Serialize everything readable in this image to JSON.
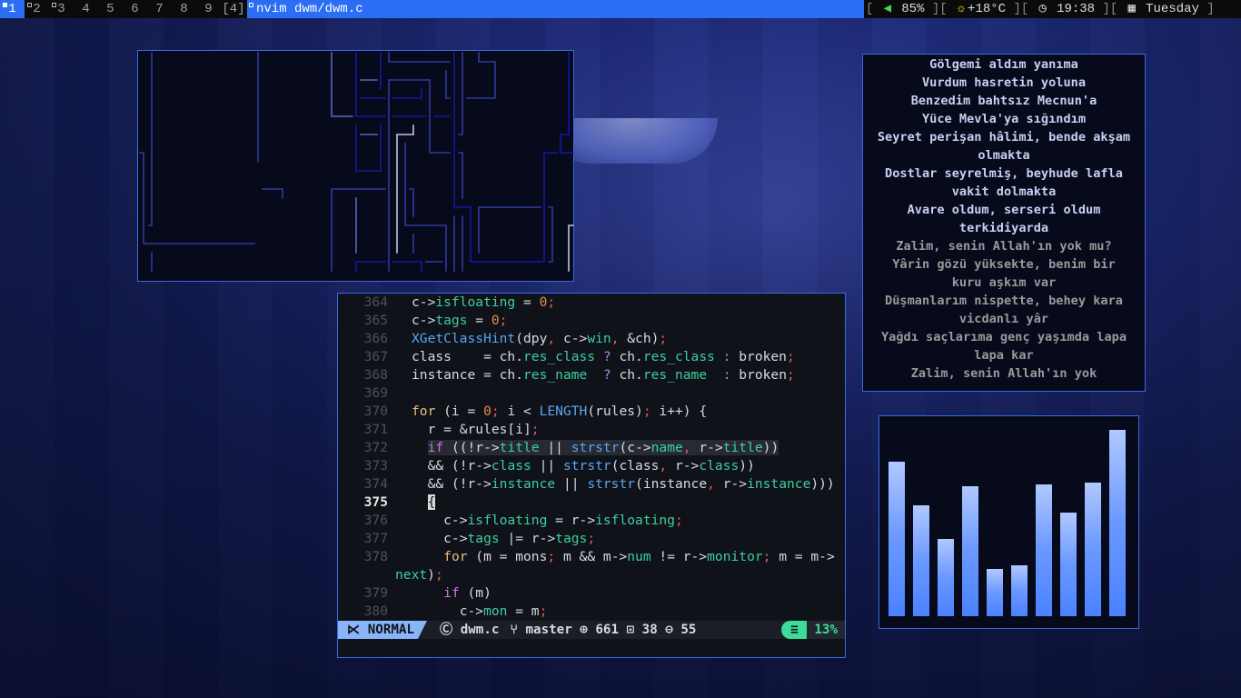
{
  "bar": {
    "tags": [
      "1",
      "2",
      "3",
      "4",
      "5",
      "6",
      "7",
      "8",
      "9"
    ],
    "selected_tag": "1",
    "layout": "[4]",
    "title": "nvim dwm/dwm.c",
    "volume": "85%",
    "weather": "+18°C",
    "time": "19:38",
    "day": "Tuesday"
  },
  "colors": {
    "accent": "#2b6ef5",
    "border": "#3a6ae0",
    "panel_bg": "#060a1b",
    "editor_bg": "#0f1219",
    "mode_bg": "#8ab4f8",
    "percent": "#3ddc97"
  },
  "lyrics": {
    "lines": [
      {
        "text": "Gölgemi aldım yanıma",
        "dim": false
      },
      {
        "text": "Vurdum hasretin yoluna",
        "dim": false
      },
      {
        "text": "Benzedim bahtsız Mecnun'a",
        "dim": false
      },
      {
        "text": "Yüce Mevla'ya sığındım",
        "dim": false
      },
      {
        "text": "Seyret perişan hâlimi, bende akşam",
        "dim": false
      },
      {
        "text": "olmakta",
        "dim": false
      },
      {
        "text": "Dostlar seyrelmiş, beyhude lafla",
        "dim": false
      },
      {
        "text": "vakit dolmakta",
        "dim": false
      },
      {
        "text": "Avare oldum, serseri oldum",
        "dim": false
      },
      {
        "text": "terkidiyarda",
        "dim": false
      },
      {
        "text": "Zalim, senin Allah'ın yok mu?",
        "dim": true
      },
      {
        "text": "Yârin gözü yüksekte, benim bir",
        "dim": true
      },
      {
        "text": "kuru aşkım var",
        "dim": true
      },
      {
        "text": "Düşmanlarım nispette, behey kara",
        "dim": true
      },
      {
        "text": "vicdanlı yâr",
        "dim": true
      },
      {
        "text": "Yağdı saçlarıma genç yaşımda lapa",
        "dim": true
      },
      {
        "text": "lapa kar",
        "dim": true
      },
      {
        "text": "Zalim, senin Allah'ın yok",
        "dim": true
      }
    ]
  },
  "visualizer": {
    "levels_percent": [
      82,
      59,
      41,
      69,
      25,
      27,
      70,
      55,
      71,
      99
    ]
  },
  "editor": {
    "lines": [
      {
        "n": "364",
        "t": [
          [
            "c->",
            ""
          ],
          [
            "isfloating",
            "f"
          ],
          [
            " = ",
            ""
          ],
          [
            "0",
            "n"
          ],
          [
            ";",
            "p"
          ]
        ]
      },
      {
        "n": "365",
        "t": [
          [
            "c->",
            ""
          ],
          [
            "tags",
            "f"
          ],
          [
            " = ",
            ""
          ],
          [
            "0",
            "n"
          ],
          [
            ";",
            "p"
          ]
        ]
      },
      {
        "n": "366",
        "t": [
          [
            "XGetClassHint",
            "fn"
          ],
          [
            "(dpy",
            ""
          ],
          [
            ", ",
            "p"
          ],
          [
            "c->",
            ""
          ],
          [
            "win",
            "f"
          ],
          [
            ", ",
            "p"
          ],
          [
            "&ch)",
            ""
          ],
          [
            ";",
            "p"
          ]
        ]
      },
      {
        "n": "367",
        "t": [
          [
            "class    = ch.",
            ""
          ],
          [
            "res_class",
            "f"
          ],
          [
            " ? ",
            "q"
          ],
          [
            "ch.",
            ""
          ],
          [
            "res_class",
            "f"
          ],
          [
            " : ",
            "q"
          ],
          [
            "broken",
            ""
          ],
          [
            ";",
            "p"
          ]
        ]
      },
      {
        "n": "368",
        "t": [
          [
            "instance = ch.",
            ""
          ],
          [
            "res_name",
            "f"
          ],
          [
            "  ? ",
            "q"
          ],
          [
            "ch.",
            ""
          ],
          [
            "res_name",
            "f"
          ],
          [
            "  : ",
            "q"
          ],
          [
            "broken",
            ""
          ],
          [
            ";",
            "p"
          ]
        ]
      },
      {
        "n": "369",
        "t": []
      },
      {
        "n": "370",
        "t": [
          [
            "for",
            "kw"
          ],
          [
            " (i = ",
            ""
          ],
          [
            "0",
            "n"
          ],
          [
            ";",
            "p"
          ],
          [
            " i < ",
            ""
          ],
          [
            "LENGTH",
            "fn"
          ],
          [
            "(rules)",
            ""
          ],
          [
            ";",
            "p"
          ],
          [
            " i++) {",
            ""
          ]
        ]
      },
      {
        "n": "371",
        "t": [
          [
            "  r = &rules[i]",
            ""
          ],
          [
            ";",
            "p"
          ]
        ]
      },
      {
        "n": "372",
        "hl": true,
        "t": [
          [
            "  ",
            ""
          ],
          [
            "if",
            "if"
          ],
          [
            " ((!r->",
            ""
          ],
          [
            "title",
            "f"
          ],
          [
            " || ",
            ""
          ],
          [
            "strstr",
            "fn"
          ],
          [
            "(c->",
            ""
          ],
          [
            "name",
            "f"
          ],
          [
            ", ",
            "p"
          ],
          [
            "r->",
            ""
          ],
          [
            "title",
            "f"
          ],
          [
            "))",
            ""
          ]
        ]
      },
      {
        "n": "373",
        "t": [
          [
            "  && (!r->",
            ""
          ],
          [
            "class",
            "f"
          ],
          [
            " || ",
            ""
          ],
          [
            "strstr",
            "fn"
          ],
          [
            "(class",
            ""
          ],
          [
            ", ",
            "p"
          ],
          [
            "r->",
            ""
          ],
          [
            "class",
            "f"
          ],
          [
            "))",
            ""
          ]
        ]
      },
      {
        "n": "374",
        "t": [
          [
            "  && (!r->",
            ""
          ],
          [
            "instance",
            "f"
          ],
          [
            " || ",
            ""
          ],
          [
            "strstr",
            "fn"
          ],
          [
            "(instance",
            ""
          ],
          [
            ", ",
            "p"
          ],
          [
            "r->",
            ""
          ],
          [
            "instance",
            "f"
          ],
          [
            ")))",
            ""
          ]
        ]
      },
      {
        "n": "375",
        "cur": true,
        "t": [
          [
            "  ",
            ""
          ],
          [
            "{",
            "cur"
          ]
        ]
      },
      {
        "n": "376",
        "t": [
          [
            "    c->",
            ""
          ],
          [
            "isfloating",
            "f"
          ],
          [
            " = r->",
            ""
          ],
          [
            "isfloating",
            "f"
          ],
          [
            ";",
            "p"
          ]
        ]
      },
      {
        "n": "377",
        "t": [
          [
            "    c->",
            ""
          ],
          [
            "tags",
            "f"
          ],
          [
            " |= r->",
            ""
          ],
          [
            "tags",
            "f"
          ],
          [
            ";",
            "p"
          ]
        ]
      },
      {
        "n": "378",
        "t": [
          [
            "    ",
            ""
          ],
          [
            "for",
            "kw"
          ],
          [
            " (m = mons",
            ""
          ],
          [
            ";",
            "p"
          ],
          [
            " m && m->",
            ""
          ],
          [
            "num",
            "f"
          ],
          [
            " != r->",
            ""
          ],
          [
            "monitor",
            "f"
          ],
          [
            ";",
            "p"
          ],
          [
            " m = m->",
            ""
          ]
        ]
      },
      {
        "n": "",
        "wrap": true,
        "t": [
          [
            "next",
            "f"
          ],
          [
            ")",
            ""
          ],
          [
            ";",
            "p"
          ]
        ]
      },
      {
        "n": "379",
        "t": [
          [
            "    ",
            ""
          ],
          [
            "if",
            "if"
          ],
          [
            " (m)",
            ""
          ]
        ]
      },
      {
        "n": "380",
        "t": [
          [
            "      c->",
            ""
          ],
          [
            "mon",
            "f"
          ],
          [
            " = m",
            ""
          ],
          [
            ";",
            "p"
          ]
        ]
      }
    ]
  },
  "statusline": {
    "mode": "NORMAL",
    "file": "dwm.c",
    "branch": "master",
    "added": "661",
    "modified": "38",
    "removed": "55",
    "percent": "13%"
  }
}
